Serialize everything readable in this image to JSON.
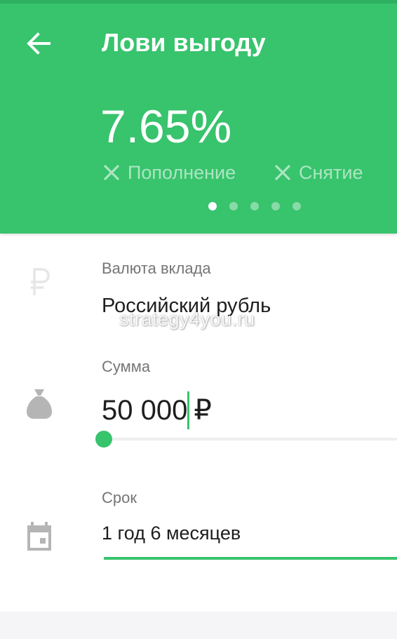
{
  "header": {
    "title": "Лови выгоду",
    "rate": "7.65%",
    "conditions": [
      {
        "label": "Пополнение",
        "icon": "x-icon"
      },
      {
        "label": "Снятие",
        "icon": "x-icon"
      }
    ],
    "pager": {
      "count": 5,
      "active_index": 0
    }
  },
  "fields": {
    "currency": {
      "label": "Валюта вклада",
      "value": "Российский рубль",
      "icon": "ruble-icon"
    },
    "amount": {
      "label": "Сумма",
      "value": "50 000",
      "currency_symbol": "₽",
      "icon": "money-bag-icon",
      "slider_level": 0.0
    },
    "term": {
      "label": "Срок",
      "value": "1 год 6 месяцев",
      "icon": "calendar-icon"
    }
  },
  "watermark": "strategy4you.ru",
  "colors": {
    "accent": "#38c36d",
    "text_primary": "#1e1e1e",
    "text_secondary": "#757575",
    "icon_gray": "#b5b5b5"
  }
}
